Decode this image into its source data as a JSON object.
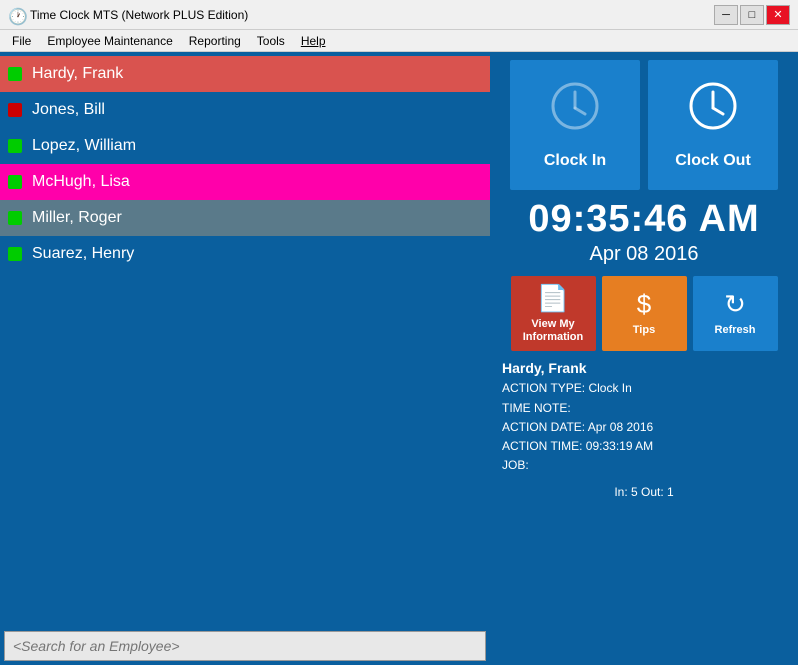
{
  "titleBar": {
    "title": "Time Clock MTS (Network PLUS Edition)",
    "icon": "clock"
  },
  "menuBar": {
    "items": [
      {
        "id": "file",
        "label": "File"
      },
      {
        "id": "employee-maintenance",
        "label": "Employee Maintenance"
      },
      {
        "id": "reporting",
        "label": "Reporting"
      },
      {
        "id": "tools",
        "label": "Tools"
      },
      {
        "id": "help",
        "label": "Help"
      }
    ]
  },
  "employees": [
    {
      "id": 1,
      "name": "Hardy, Frank",
      "status": "in",
      "selected": "orange"
    },
    {
      "id": 2,
      "name": "Jones, Bill",
      "status": "out",
      "selected": "none"
    },
    {
      "id": 3,
      "name": "Lopez, William",
      "status": "in",
      "selected": "none"
    },
    {
      "id": 4,
      "name": "McHugh, Lisa",
      "status": "in",
      "selected": "magenta"
    },
    {
      "id": 5,
      "name": "Miller, Roger",
      "status": "in",
      "selected": "gray"
    },
    {
      "id": 6,
      "name": "Suarez, Henry",
      "status": "in",
      "selected": "none"
    }
  ],
  "searchPlaceholder": "<Search for an Employee>",
  "clockButtons": {
    "clockIn": "Clock In",
    "clockOut": "Clock Out"
  },
  "timeDisplay": "09:35:46 AM",
  "dateDisplay": "Apr 08 2016",
  "actionButtons": {
    "info": "View My Information",
    "infoShort": "View My\nInformation",
    "tips": "Tips",
    "refresh": "Refresh"
  },
  "infoPanel": {
    "name": "Hardy, Frank",
    "actionType": "ACTION TYPE: Clock In",
    "timeNote": "TIME NOTE:",
    "actionDate": "ACTION DATE: Apr 08 2016",
    "actionTime": "ACTION TIME: 09:33:19 AM",
    "job": "JOB:"
  },
  "footer": {
    "inOut": "In: 5  Out: 1"
  }
}
